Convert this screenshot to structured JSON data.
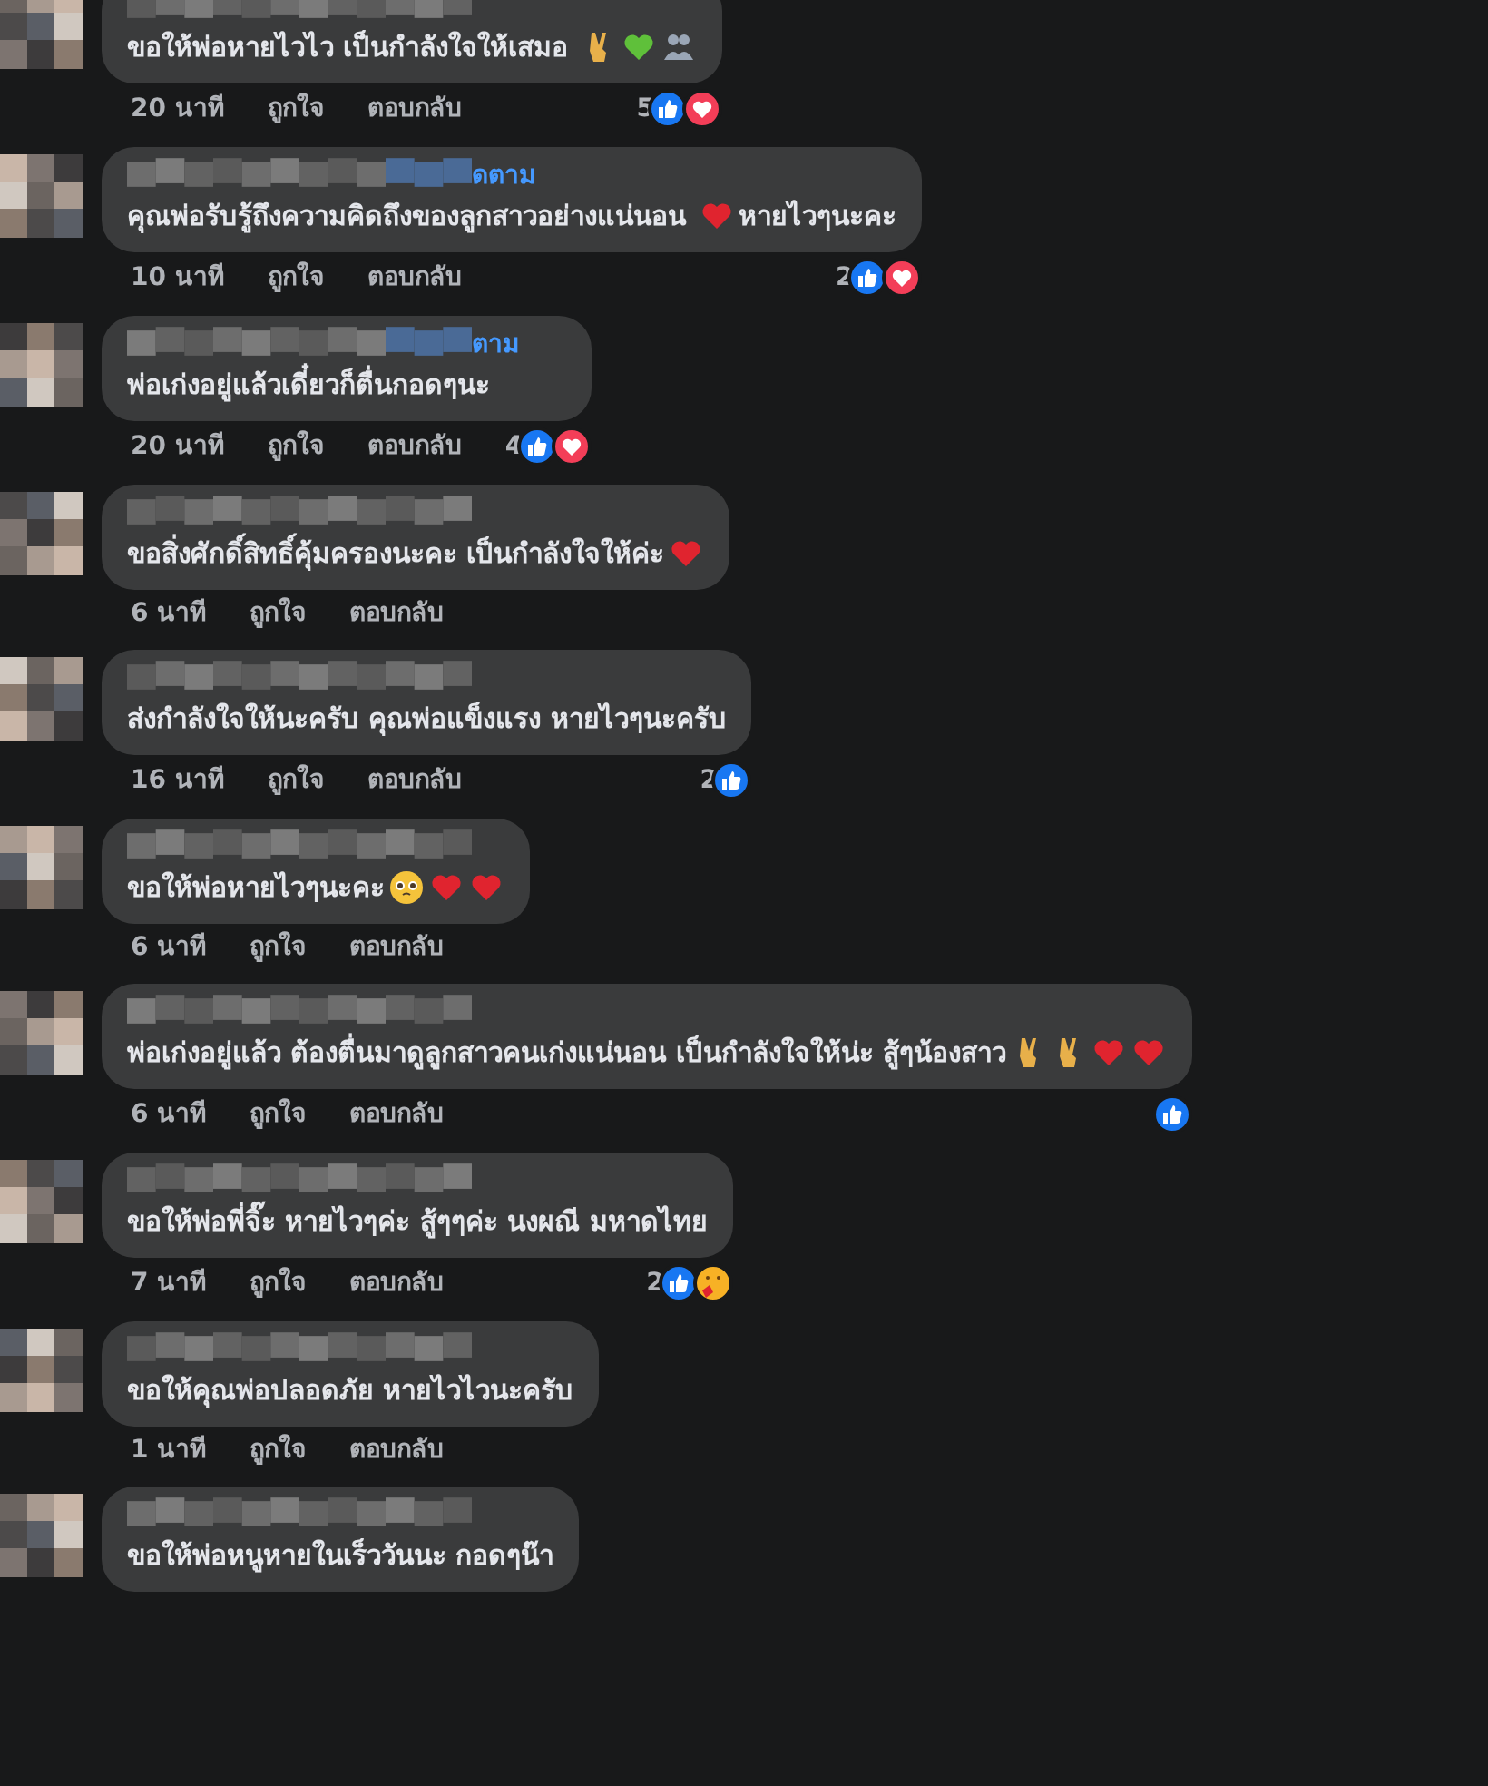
{
  "comments": [
    {
      "body": [
        {
          "kind": "text",
          "text": "ขอให้พ่อหายไวไว เป็นกำลังใจให้เสมอ "
        },
        {
          "kind": "victory"
        },
        {
          "kind": "green-heart"
        },
        {
          "kind": "people"
        }
      ],
      "time": "20 นาที",
      "like_label": "ถูกใจ",
      "reply_label": "ตอบกลับ",
      "reactions": {
        "count": "5",
        "kinds": [
          {
            "kind": "like"
          },
          {
            "kind": "love"
          }
        ]
      }
    },
    {
      "follow": "ดตาม",
      "body": [
        {
          "kind": "text",
          "text": "คุณพ่อรับรู้ถึงความคิดถึงของลูกสาวอย่างแน่นอน "
        },
        {
          "kind": "red-heart"
        },
        {
          "kind": "text",
          "text": "หายไวๆนะคะ"
        }
      ],
      "time": "10 นาที",
      "like_label": "ถูกใจ",
      "reply_label": "ตอบกลับ",
      "reactions": {
        "count": "2",
        "kinds": [
          {
            "kind": "like"
          },
          {
            "kind": "love"
          }
        ]
      }
    },
    {
      "follow": "ตาม",
      "body": [
        {
          "kind": "text",
          "text": "พ่อเก่งอยู่แล้วเดี๋ยวก็ตื่นกอดๆนะ"
        }
      ],
      "time": "20 นาที",
      "like_label": "ถูกใจ",
      "reply_label": "ตอบกลับ",
      "reactions": {
        "count": "4",
        "kinds": [
          {
            "kind": "like"
          },
          {
            "kind": "love"
          }
        ]
      }
    },
    {
      "body": [
        {
          "kind": "text",
          "text": "ขอสิ่งศักดิ์สิทธิ์คุ้มครองนะคะ เป็นกำลังใจให้ค่ะ"
        },
        {
          "kind": "red-heart"
        }
      ],
      "time": "6 นาที",
      "like_label": "ถูกใจ",
      "reply_label": "ตอบกลับ"
    },
    {
      "body": [
        {
          "kind": "text",
          "text": "ส่งกำลังใจให้นะครับ คุณพ่อแข็งแรง หายไวๆนะครับ"
        }
      ],
      "time": "16 นาที",
      "like_label": "ถูกใจ",
      "reply_label": "ตอบกลับ",
      "reactions": {
        "count": "2",
        "kinds": [
          {
            "kind": "like"
          }
        ]
      }
    },
    {
      "body": [
        {
          "kind": "text",
          "text": "ขอให้พ่อหายไวๆนะคะ"
        },
        {
          "kind": "pleading"
        },
        {
          "kind": "red-heart"
        },
        {
          "kind": "red-heart"
        }
      ],
      "time": "6 นาที",
      "like_label": "ถูกใจ",
      "reply_label": "ตอบกลับ"
    },
    {
      "body": [
        {
          "kind": "text",
          "text": "พ่อเก่งอยู่แล้ว ต้องตื่นมาดูลูกสาวคนเก่งแน่นอน เป็นกำลังใจให้น่ะ สู้ๆน้องสาว"
        },
        {
          "kind": "victory"
        },
        {
          "kind": "victory"
        },
        {
          "kind": "red-heart"
        },
        {
          "kind": "red-heart"
        }
      ],
      "time": "6 นาที",
      "like_label": "ถูกใจ",
      "reply_label": "ตอบกลับ",
      "reactions": {
        "kinds": [
          {
            "kind": "like"
          }
        ]
      }
    },
    {
      "body": [
        {
          "kind": "text",
          "text": "ขอให้พ่อพี่จิ๊ะ หายไวๆค่ะ สู้ๆๆค่ะ นงผณี มหาดไทย"
        }
      ],
      "time": "7 นาที",
      "like_label": "ถูกใจ",
      "reply_label": "ตอบกลับ",
      "reactions": {
        "count": "2",
        "kinds": [
          {
            "kind": "like"
          },
          {
            "kind": "care"
          }
        ]
      }
    },
    {
      "body": [
        {
          "kind": "text",
          "text": "ขอให้คุณพ่อปลอดภัย หายไวไวนะครับ"
        }
      ],
      "time": "1 นาที",
      "like_label": "ถูกใจ",
      "reply_label": "ตอบกลับ"
    },
    {
      "body": [
        {
          "kind": "text",
          "text": "ขอให้พ่อหนูหายในเร็ววันนะ กอดๆน๊า"
        }
      ]
    }
  ]
}
